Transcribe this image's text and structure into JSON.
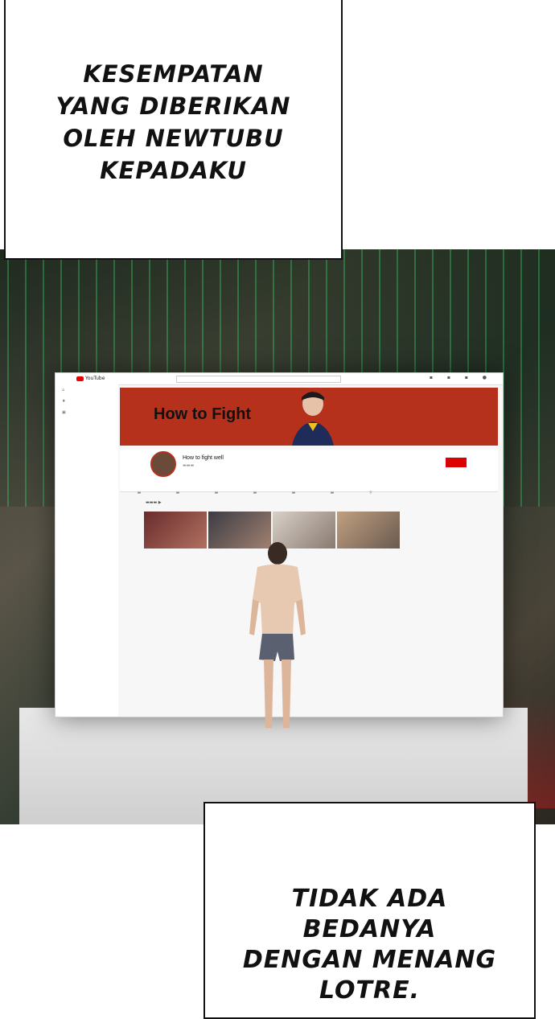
{
  "caption_top": {
    "lines": [
      "KESEMPATAN",
      "YANG DIBERIKAN",
      "OLEH NEWTUBU",
      "KEPADAKU"
    ]
  },
  "caption_bottom": {
    "lines": [
      "TIDAK ADA",
      "BEDANYA",
      "DENGAN MENANG",
      "LOTRE."
    ]
  },
  "screen": {
    "logo": "YouTube",
    "banner_title": "How to Fight",
    "channel_name": "How to fight well",
    "colors": {
      "banner": "#b5311c",
      "subscribe": "#dd0000"
    }
  }
}
